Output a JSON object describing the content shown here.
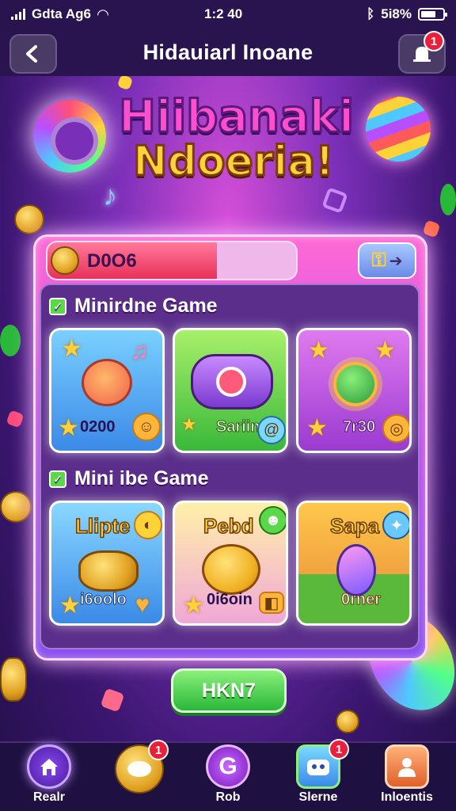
{
  "status_bar": {
    "carrier": "Gdta Ag6",
    "time": "1:2 40",
    "battery": "5i8%"
  },
  "app_bar": {
    "title": "Hidauiarl Inoane",
    "notification_count": "1"
  },
  "logo": {
    "line1": "Hiibanaki",
    "line2": "Ndoeria!"
  },
  "progress": {
    "label": "D0O6",
    "fraction": 0.68
  },
  "sections": [
    {
      "title": "Minirdne Game",
      "tiles": [
        {
          "name": "Monster",
          "value": "0200",
          "color_top": "#7ad0ff",
          "color_bottom": "#3a8ae8"
        },
        {
          "name": "Controller",
          "value": "Sariin",
          "color_top": "#a8f06a",
          "color_bottom": "#3ab83a"
        },
        {
          "name": "Sun",
          "value": "7r30",
          "color_top": "#e07af0",
          "color_bottom": "#9a3ad0"
        }
      ]
    },
    {
      "title": "Mini ibe Game",
      "tiles": [
        {
          "title": "Llipte",
          "value": "i6oolo",
          "color_top": "#8ad8ff",
          "color_bottom": "#3a8ae8"
        },
        {
          "title": "Pebd",
          "value": "0i6oin",
          "color_top": "#fff0a8",
          "color_bottom": "#f0a8d8"
        },
        {
          "title": "Sapa",
          "value": "0rner",
          "color_top": "#ffc84a",
          "color_bottom": "#e8883a"
        }
      ]
    }
  ],
  "cta": {
    "label": "HKN7"
  },
  "nav": {
    "items": [
      {
        "label": "Realr",
        "icon": "home-icon",
        "badge": ""
      },
      {
        "label": "",
        "icon": "coin-icon",
        "badge": "1"
      },
      {
        "label": "Rob",
        "icon": "g-icon",
        "badge": ""
      },
      {
        "label": "Slerne",
        "icon": "robot-icon",
        "badge": "1"
      },
      {
        "label": "Inloentis",
        "icon": "profile-icon",
        "badge": ""
      }
    ]
  }
}
